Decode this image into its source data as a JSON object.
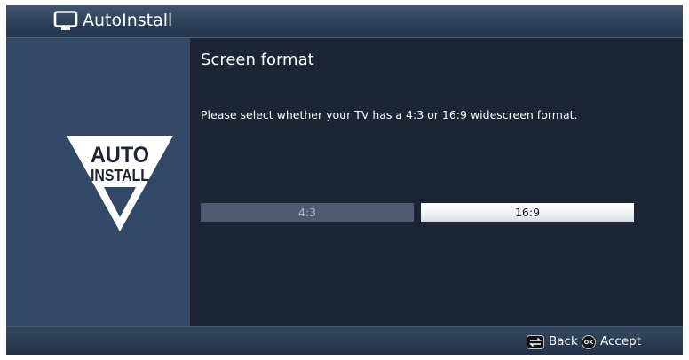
{
  "header": {
    "title": "AutoInstall",
    "icon": "tv-icon"
  },
  "sidebar": {
    "logo": {
      "line1": "AUTO",
      "line2": "INSTALL",
      "icon": "autoinstall-triangle-logo"
    }
  },
  "main": {
    "title": "Screen format",
    "prompt": "Please select whether your TV has a 4:3 or 16:9 widescreen format.",
    "options": [
      {
        "label": "4:3",
        "selected": false
      },
      {
        "label": "16:9",
        "selected": true
      }
    ]
  },
  "footer": {
    "back_label": "Back",
    "back_icon": "back-arrows-icon",
    "ok_badge": "OK",
    "accept_label": "Accept",
    "accept_icon": "ok-button-icon"
  },
  "colors": {
    "background": "#1d2436",
    "sidebar": "#314866",
    "header": "#2d4059",
    "selected_option": "#ffffff",
    "unselected_option": "#4d5a6f"
  }
}
